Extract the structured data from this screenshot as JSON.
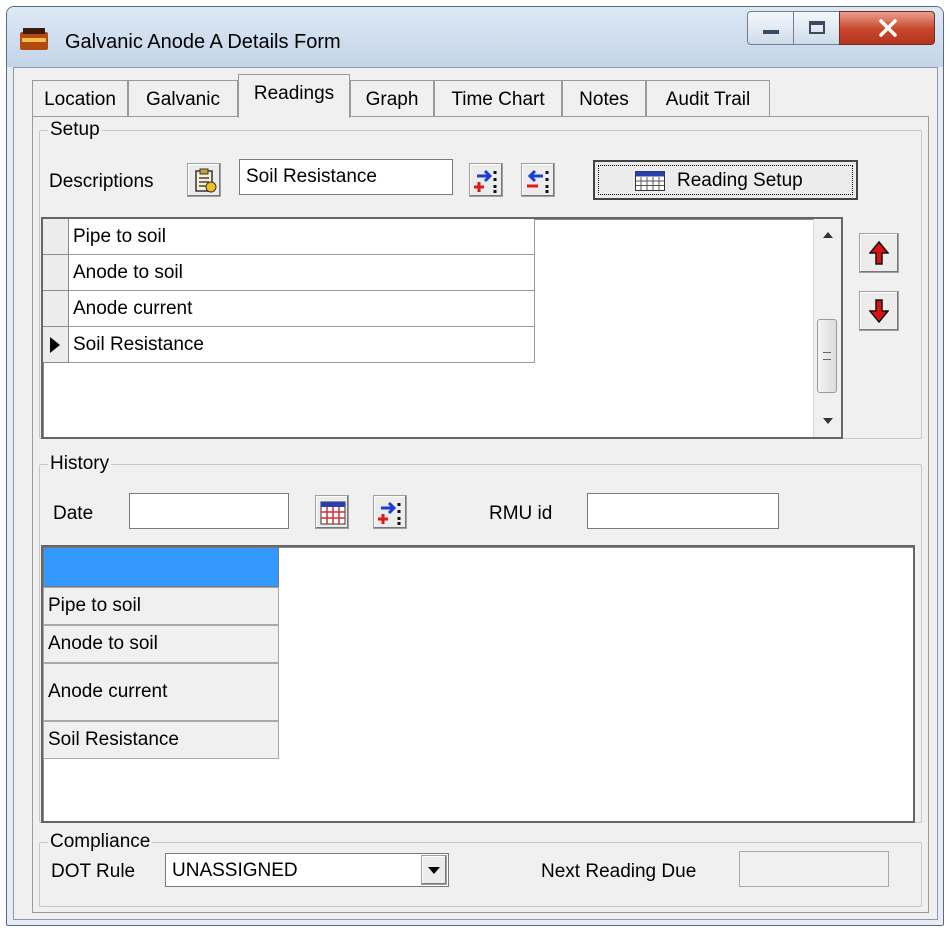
{
  "window": {
    "title": "Galvanic Anode A Details Form",
    "accent_colors": {
      "titlebar": "#c4d4e8",
      "close": "#c8462b",
      "selection": "#3399ff"
    }
  },
  "tabs": [
    {
      "label": "Location"
    },
    {
      "label": "Galvanic"
    },
    {
      "label": "Readings",
      "active": true
    },
    {
      "label": "Graph"
    },
    {
      "label": "Time Chart"
    },
    {
      "label": "Notes"
    },
    {
      "label": "Audit Trail"
    }
  ],
  "setup": {
    "legend": "Setup",
    "descriptions_label": "Descriptions",
    "description_value": "Soil Resistance",
    "reading_setup_label": "Reading Setup",
    "rows": [
      {
        "label": "Pipe to soil"
      },
      {
        "label": "Anode to soil"
      },
      {
        "label": "Anode current"
      },
      {
        "label": "Soil Resistance",
        "current": true
      }
    ]
  },
  "history": {
    "legend": "History",
    "date_label": "Date",
    "date_value": "",
    "rmu_label": "RMU id",
    "rmu_value": "",
    "rows": [
      {
        "label": "Pipe to soil"
      },
      {
        "label": "Anode to soil"
      },
      {
        "label": "Anode current"
      },
      {
        "label": "Soil Resistance"
      }
    ]
  },
  "compliance": {
    "legend": "Compliance",
    "dot_rule_label": "DOT Rule",
    "dot_rule_value": "UNASSIGNED",
    "next_reading_label": "Next Reading Due",
    "next_reading_value": ""
  }
}
